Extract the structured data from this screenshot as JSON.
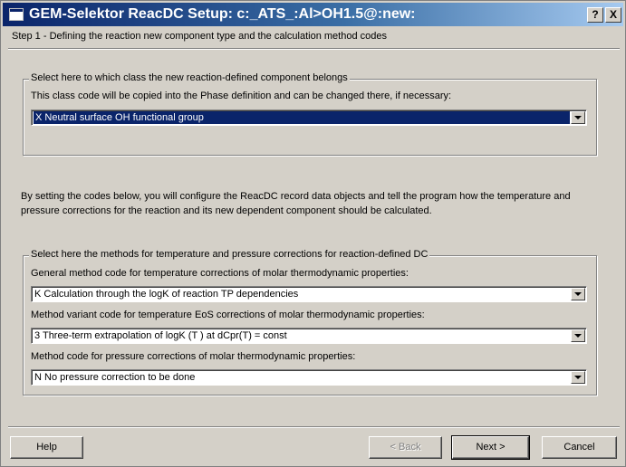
{
  "window": {
    "title": "GEM-Selektor ReacDC Setup:  c:_ATS_:Al>OH1.5@:new:",
    "help_btn": "?",
    "close_btn": "X"
  },
  "step_label": "Step 1 - Defining the reaction new component type and the calculation method codes",
  "class_group": {
    "title": "Select here to which class the new reaction-defined component belongs",
    "description": "This class code will be copied into the Phase definition and can be changed there, if necessary:",
    "selected_value": "X   Neutral surface OH functional group"
  },
  "info_paragraph": "By setting the codes below, you will configure the ReacDC record data objects and tell the program how the temperature and pressure corrections for the reaction and its new dependent component should be calculated.",
  "methods_group": {
    "title": "Select here the methods for temperature and pressure corrections for reaction-defined DC",
    "general_label": "General method code for temperature corrections of molar thermodynamic properties:",
    "general_value": "K   Calculation through the logK of reaction TP dependencies",
    "variant_label": "Method variant code for temperature EoS corrections of molar thermodynamic properties:",
    "variant_value": "3   Three-term extrapolation of logK (T ) at dCpr(T) = const",
    "pressure_label": "Method code for pressure corrections of molar thermodynamic properties:",
    "pressure_value": "N   No pressure correction to be done"
  },
  "buttons": {
    "help": "Help",
    "back": "< Back",
    "next": "Next >",
    "cancel": "Cancel"
  },
  "colors": {
    "titlebar_start": "#0a246a",
    "titlebar_end": "#a6caf0",
    "selection": "#0a246a",
    "face": "#d4d0c8"
  }
}
